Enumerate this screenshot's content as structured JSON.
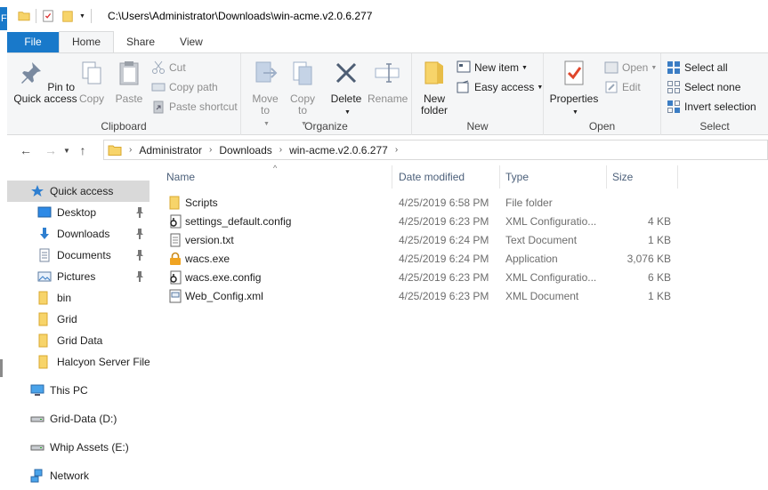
{
  "window": {
    "title_path": "C:\\Users\\Administrator\\Downloads\\win-acme.v2.0.6.277",
    "edge_letter": "F"
  },
  "ribbon_tabs": [
    {
      "label": "File"
    },
    {
      "label": "Home"
    },
    {
      "label": "Share"
    },
    {
      "label": "View"
    }
  ],
  "clipboard": {
    "pin": "Pin to Quick access",
    "copy": "Copy",
    "paste": "Paste",
    "cut": "Cut",
    "copy_path": "Copy path",
    "paste_shortcut": "Paste shortcut",
    "label": "Clipboard"
  },
  "organize": {
    "move_to": "Move to",
    "copy_to": "Copy to",
    "delete": "Delete",
    "rename": "Rename",
    "label": "Organize"
  },
  "new_group": {
    "new_folder": "New folder",
    "new_item": "New item",
    "easy_access": "Easy access",
    "label": "New"
  },
  "open_group": {
    "properties": "Properties",
    "open": "Open",
    "edit": "Edit",
    "label": "Open"
  },
  "select_group": {
    "select_all": "Select all",
    "select_none": "Select none",
    "invert": "Invert selection",
    "label": "Select"
  },
  "breadcrumb": [
    "Administrator",
    "Downloads",
    "win-acme.v2.0.6.277"
  ],
  "nav_pane": {
    "quick_access": "Quick access",
    "pinned": [
      "Desktop",
      "Downloads",
      "Documents",
      "Pictures"
    ],
    "folders": [
      "bin",
      "Grid",
      "Grid Data",
      "Halcyon Server Files"
    ],
    "this_pc": "This PC",
    "drive_d": "Grid-Data (D:)",
    "drive_e": "Whip Assets (E:)",
    "network": "Network"
  },
  "columns": {
    "name": "Name",
    "date": "Date modified",
    "type": "Type",
    "size": "Size"
  },
  "files": [
    {
      "name": "Scripts",
      "date": "4/25/2019 6:58 PM",
      "type": "File folder",
      "size": "",
      "icon": "folder-icon"
    },
    {
      "name": "settings_default.config",
      "date": "4/25/2019 6:23 PM",
      "type": "XML Configuratio...",
      "size": "4 KB",
      "icon": "config-file-icon"
    },
    {
      "name": "version.txt",
      "date": "4/25/2019 6:24 PM",
      "type": "Text Document",
      "size": "1 KB",
      "icon": "text-file-icon"
    },
    {
      "name": "wacs.exe",
      "date": "4/25/2019 6:24 PM",
      "type": "Application",
      "size": "3,076 KB",
      "icon": "lock-icon"
    },
    {
      "name": "wacs.exe.config",
      "date": "4/25/2019 6:23 PM",
      "type": "XML Configuratio...",
      "size": "6 KB",
      "icon": "config-file-icon"
    },
    {
      "name": "Web_Config.xml",
      "date": "4/25/2019 6:23 PM",
      "type": "XML Document",
      "size": "1 KB",
      "icon": "xml-file-icon"
    }
  ],
  "colors": {
    "accent": "#1979ca",
    "folder": "#f7d46a",
    "ribbon_bg": "#f5f6f7"
  }
}
